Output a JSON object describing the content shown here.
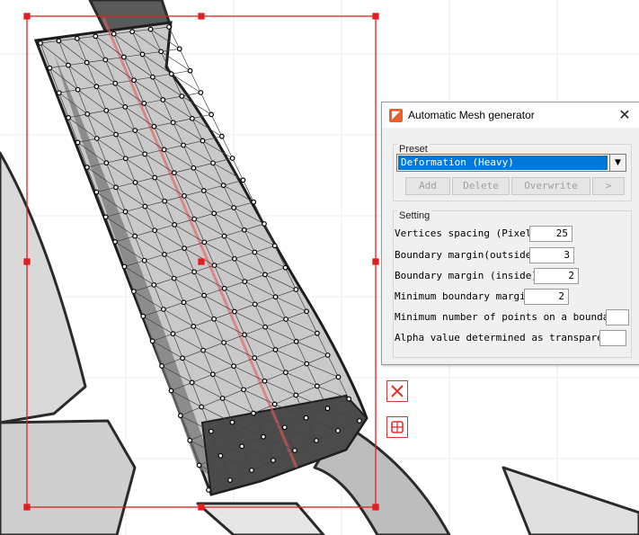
{
  "dialog": {
    "title": "Automatic Mesh generator",
    "close_label": "✕",
    "preset": {
      "label": "Preset",
      "selected": "Deformation (Heavy)",
      "buttons": {
        "add": "Add",
        "delete": "Delete",
        "overwrite": "Overwrite",
        "next": ">"
      }
    },
    "setting": {
      "label": "Setting",
      "rows": [
        {
          "label": "Vertices spacing (Pixel)",
          "value": "25"
        },
        {
          "label": "Boundary margin(outside)",
          "value": "3"
        },
        {
          "label": "Boundary margin (inside)",
          "value": "2"
        },
        {
          "label": "Minimum boundary margin",
          "value": "2"
        },
        {
          "label": "Minimum number of points on a boundary",
          "value": ""
        },
        {
          "label": "Alpha value determined as transparent",
          "value": ""
        }
      ]
    }
  },
  "canvas_tools": {
    "cancel_icon": "x-mark-icon",
    "apply_icon": "mesh-grid-icon"
  },
  "colors": {
    "selection": "#e02020",
    "selected_item": "#0078d7",
    "accent": "#e8602c"
  }
}
